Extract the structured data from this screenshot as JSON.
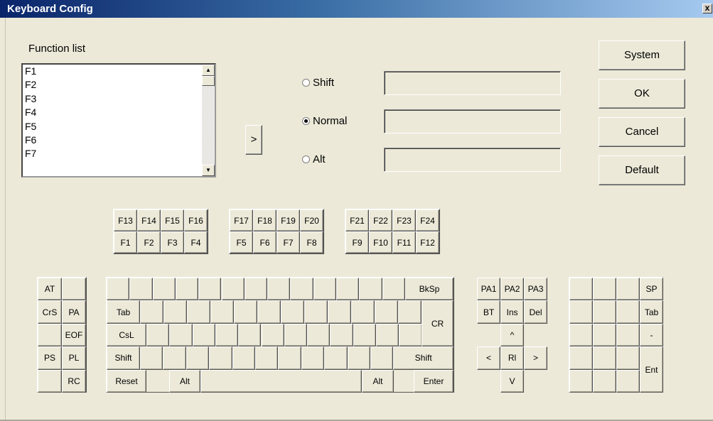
{
  "window": {
    "title": "Keyboard Config",
    "close_label": "x"
  },
  "function_list": {
    "label": "Function list",
    "items": [
      "F1",
      "F2",
      "F3",
      "F4",
      "F5",
      "F6",
      "F7"
    ],
    "scroll_up_icon": "up-arrow-icon",
    "scroll_down_icon": "down-arrow-icon"
  },
  "assign_button": {
    "label": ">"
  },
  "modifiers": [
    {
      "label": "Shift",
      "selected": false,
      "value": ""
    },
    {
      "label": "Normal",
      "selected": true,
      "value": ""
    },
    {
      "label": "Alt",
      "selected": false,
      "value": ""
    }
  ],
  "side_buttons": [
    "System",
    "OK",
    "Cancel",
    "Default"
  ],
  "fkey_groups": [
    {
      "top": [
        "F13",
        "F14",
        "F15",
        "F16"
      ],
      "bottom": [
        "F1",
        "F2",
        "F3",
        "F4"
      ]
    },
    {
      "top": [
        "F17",
        "F18",
        "F19",
        "F20"
      ],
      "bottom": [
        "F5",
        "F6",
        "F7",
        "F8"
      ]
    },
    {
      "top": [
        "F21",
        "F22",
        "F23",
        "F24"
      ],
      "bottom": [
        "F9",
        "F10",
        "F11",
        "F12"
      ]
    }
  ],
  "left_panel": [
    [
      "AT",
      ""
    ],
    [
      "CrS",
      "PA"
    ],
    [
      "",
      "EOF"
    ],
    [
      "PS",
      "PL"
    ],
    [
      "",
      "RC"
    ]
  ],
  "main_keyboard": {
    "row1_right": "BkSp",
    "row2_left": "Tab",
    "row3_left": "CsL",
    "row4_left": "Shift",
    "row4_right": "Shift",
    "cr": "CR",
    "row5": [
      "Reset",
      "Alt",
      "",
      "Alt",
      "Enter"
    ]
  },
  "nav_cluster": {
    "row1": [
      "PA1",
      "PA2",
      "PA3"
    ],
    "row2": [
      "BT",
      "Ins",
      "Del"
    ],
    "up": "^",
    "left": "<",
    "center": "Rl",
    "right": ">",
    "down": "V"
  },
  "right_panel": {
    "col4": [
      "SP",
      "Tab",
      "-",
      "Ent"
    ]
  }
}
